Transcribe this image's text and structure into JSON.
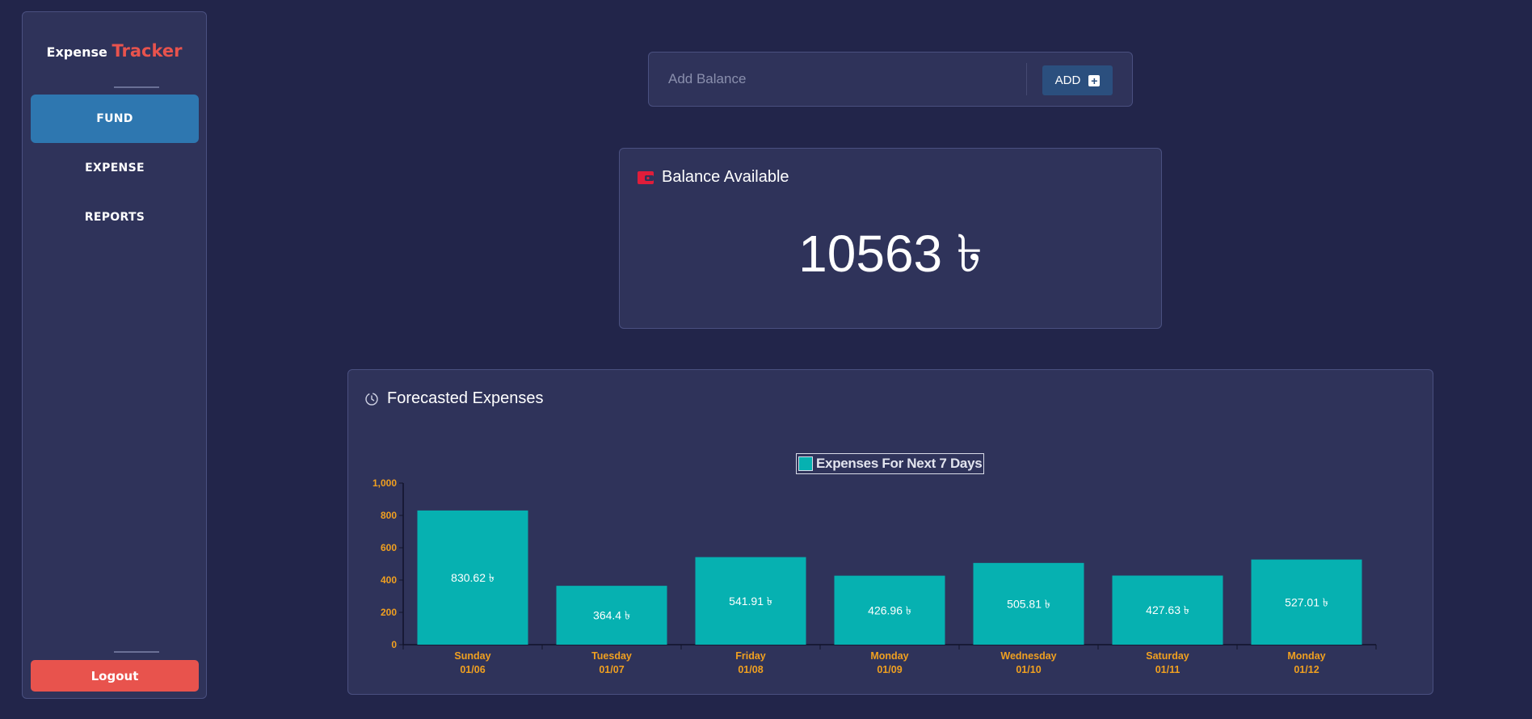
{
  "sidebar": {
    "brand_part1": "Expense",
    "brand_part2": "Tracker",
    "items": [
      {
        "label": "FUND",
        "active": true
      },
      {
        "label": "EXPENSE",
        "active": false
      },
      {
        "label": "REPORTS",
        "active": false
      }
    ],
    "logout_label": "Logout"
  },
  "add_balance": {
    "placeholder": "Add Balance",
    "value": "",
    "button_label": "ADD"
  },
  "balance": {
    "title": "Balance Available",
    "amount": "10563 ৳"
  },
  "forecast": {
    "title": "Forecasted Expenses",
    "legend_label": "Expenses For Next 7 Days"
  },
  "colors": {
    "background": "#22254a",
    "card": "#2f335a",
    "accent_red": "#e8534d",
    "active_blue": "#2e77b0",
    "bar": "#06b1b1",
    "tick": "#f0a020"
  },
  "chart_data": {
    "type": "bar",
    "categories": [
      [
        "Sunday",
        "01/06"
      ],
      [
        "Tuesday",
        "01/07"
      ],
      [
        "Friday",
        "01/08"
      ],
      [
        "Monday",
        "01/09"
      ],
      [
        "Wednesday",
        "01/10"
      ],
      [
        "Saturday",
        "01/11"
      ],
      [
        "Monday",
        "01/12"
      ]
    ],
    "series": [
      {
        "name": "Expenses For Next 7 Days",
        "values": [
          830.62,
          364.4,
          541.91,
          426.96,
          505.81,
          427.63,
          527.01
        ],
        "labels": [
          "830.62 ৳",
          "364.4 ৳",
          "541.91 ৳",
          "426.96 ৳",
          "505.81 ৳",
          "427.63 ৳",
          "527.01 ৳"
        ]
      }
    ],
    "y_ticks": [
      "0",
      "200",
      "400",
      "600",
      "800",
      "1,000"
    ],
    "ylim": [
      0,
      1000
    ],
    "grid": false,
    "legend_position": "top-center"
  }
}
